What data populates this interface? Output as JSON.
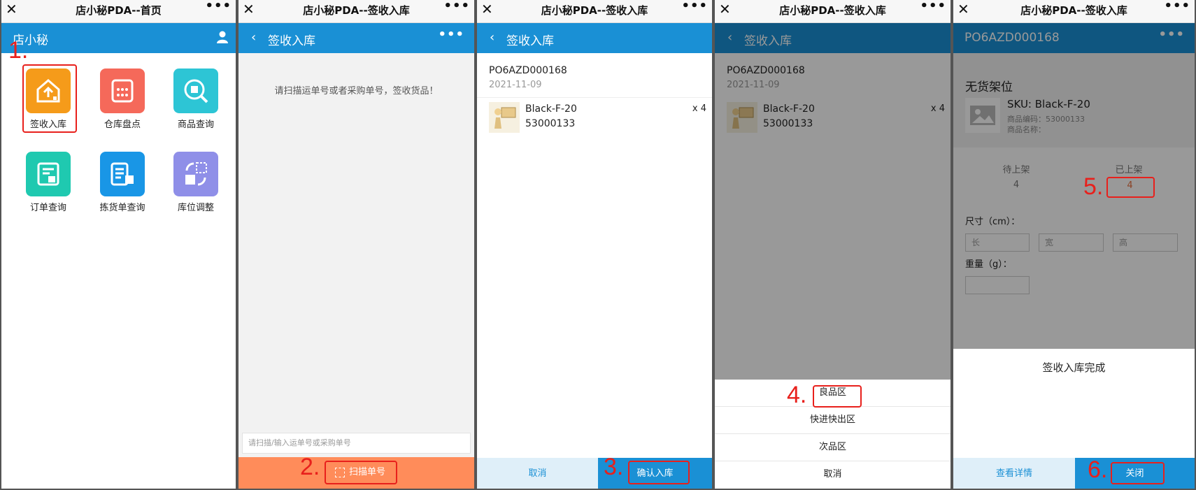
{
  "colors": {
    "brand_blue": "#1a90d5",
    "scan_orange": "#ff8c5a",
    "annotation_red": "#e8201c"
  },
  "panel1": {
    "window_title": "店小秘PDA--首页",
    "app_name": "店小秘",
    "grid": [
      {
        "label": "签收入库",
        "icon": "warehouse-in-icon",
        "color": "#f59b1a"
      },
      {
        "label": "仓库盘点",
        "icon": "calculator-icon",
        "color": "#f5695a"
      },
      {
        "label": "商品查询",
        "icon": "magnifier-icon",
        "color": "#2dc5d5"
      },
      {
        "label": "订单查询",
        "icon": "order-icon",
        "color": "#1fc9b0"
      },
      {
        "label": "拣货单查询",
        "icon": "picklist-icon",
        "color": "#1996e6"
      },
      {
        "label": "库位调整",
        "icon": "location-adjust-icon",
        "color": "#8f8fe8"
      }
    ],
    "step_label": "1."
  },
  "panel2": {
    "window_title": "店小秘PDA--签收入库",
    "nav_title": "签收入库",
    "hint": "请扫描运单号或者采购单号，签收货品！",
    "input_placeholder": "请扫描/输入运单号或采购单号",
    "scan_button": "扫描单号",
    "step_label": "2."
  },
  "panel3": {
    "window_title": "店小秘PDA--签收入库",
    "nav_title": "签收入库",
    "po_number": "PO6AZD000168",
    "date": "2021-11-09",
    "item": {
      "sku": "Black-F-20",
      "code": "53000133",
      "qty": "x 4"
    },
    "cancel": "取消",
    "confirm": "确认入库",
    "step_label": "3."
  },
  "panel4": {
    "window_title": "店小秘PDA--签收入库",
    "nav_title": "签收入库",
    "po_number": "PO6AZD000168",
    "date": "2021-11-09",
    "item": {
      "sku": "Black-F-20",
      "code": "53000133",
      "qty": "x 4"
    },
    "options": [
      "良品区",
      "快进快出区",
      "次品区",
      "取消"
    ],
    "step_label": "4."
  },
  "panel5": {
    "window_title": "店小秘PDA--签收入库",
    "nav_title": "PO6AZD000168",
    "shelf_title": "无货架位",
    "sku_line": "SKU: Black-F-20",
    "code_line": "商品编码：53000133",
    "name_line": "商品名称：",
    "pending_label": "待上架",
    "pending_value": "4",
    "shelved_label": "已上架",
    "shelved_value": "4",
    "size_label": "尺寸（cm）：",
    "length_ph": "长",
    "width_ph": "宽",
    "height_ph": "高",
    "weight_label": "重量（g）：",
    "done_message": "签收入库完成",
    "view_details": "查看详情",
    "close": "关闭",
    "step5_label": "5.",
    "step6_label": "6."
  }
}
